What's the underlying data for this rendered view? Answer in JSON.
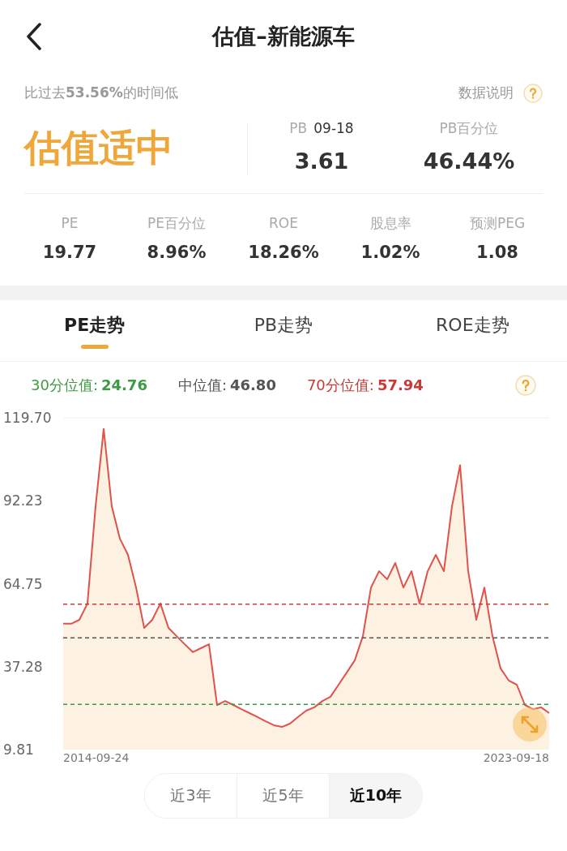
{
  "header": {
    "title": "估值–新能源车"
  },
  "summary": {
    "note": "比过去**53.56%**的时间低",
    "help_link": "数据说明",
    "verdict": "估值适中",
    "pb": {
      "label": "PB",
      "date": "09-18",
      "value": "3.61"
    },
    "pb_percentile": {
      "label": "PB百分位",
      "value": "46.44%"
    }
  },
  "metrics": [
    {
      "label": "PE",
      "value": "19.77"
    },
    {
      "label": "PE百分位",
      "value": "8.96%"
    },
    {
      "label": "ROE",
      "value": "18.26%"
    },
    {
      "label": "股息率",
      "value": "1.02%"
    },
    {
      "label": "预测PEG",
      "value": "1.08"
    }
  ],
  "tabs": [
    {
      "label": "PE走势",
      "selected": true
    },
    {
      "label": "PB走势",
      "selected": false
    },
    {
      "label": "ROE走势",
      "selected": false
    }
  ],
  "reference_lines": [
    {
      "label": "30分位值:",
      "value": "24.76",
      "color": "#3f9a44"
    },
    {
      "label": "中位值:",
      "value": "46.80",
      "color": "#555555"
    },
    {
      "label": "70分位值:",
      "value": "57.94",
      "color": "#c93a36"
    }
  ],
  "chart_data": {
    "type": "area",
    "ylim": [
      9.81,
      119.7
    ],
    "yticks": [
      {
        "value": 9.81,
        "label": "9.81"
      },
      {
        "value": 37.28,
        "label": "37.28"
      },
      {
        "value": 64.75,
        "label": "64.75"
      },
      {
        "value": 92.23,
        "label": "92.23"
      },
      {
        "value": 119.7,
        "label": "119.70"
      }
    ],
    "ref_lines": [
      {
        "axis": "y",
        "value": 24.76,
        "color": "#3f9a44"
      },
      {
        "axis": "y",
        "value": 46.8,
        "color": "#555555"
      },
      {
        "axis": "y",
        "value": 57.94,
        "color": "#c93a36"
      }
    ],
    "series": [
      {
        "color": "#e0524b",
        "values": [
          51.5,
          51.5,
          52.8,
          58.2,
          90.4,
          116,
          90.4,
          79.7,
          74.3,
          63.5,
          50.1,
          52.8,
          58.2,
          50.1,
          47.4,
          44.7,
          42.1,
          43.4,
          44.7,
          24.6,
          25.9,
          24.6,
          23.2,
          21.9,
          20.6,
          19.2,
          17.9,
          17.3,
          18.4,
          20.6,
          22.7,
          23.8,
          25.9,
          27.3,
          31.3,
          35.3,
          39.4,
          47.4,
          63.5,
          68.9,
          66.2,
          71.6,
          63.5,
          68.9,
          58.2,
          68.9,
          74.3,
          68.9,
          90.4,
          104,
          68.9,
          52.8,
          63.5,
          47.4,
          36.7,
          32.7,
          31.3,
          24.6,
          23.2,
          23.8,
          21.9
        ]
      }
    ]
  },
  "x_axis": {
    "start_date": "2014-09-24",
    "end_date": "2023-09-18"
  },
  "ranges": [
    {
      "label": "近3年",
      "selected": false
    },
    {
      "label": "近5年",
      "selected": false
    },
    {
      "label": "近10年",
      "selected": true
    }
  ]
}
